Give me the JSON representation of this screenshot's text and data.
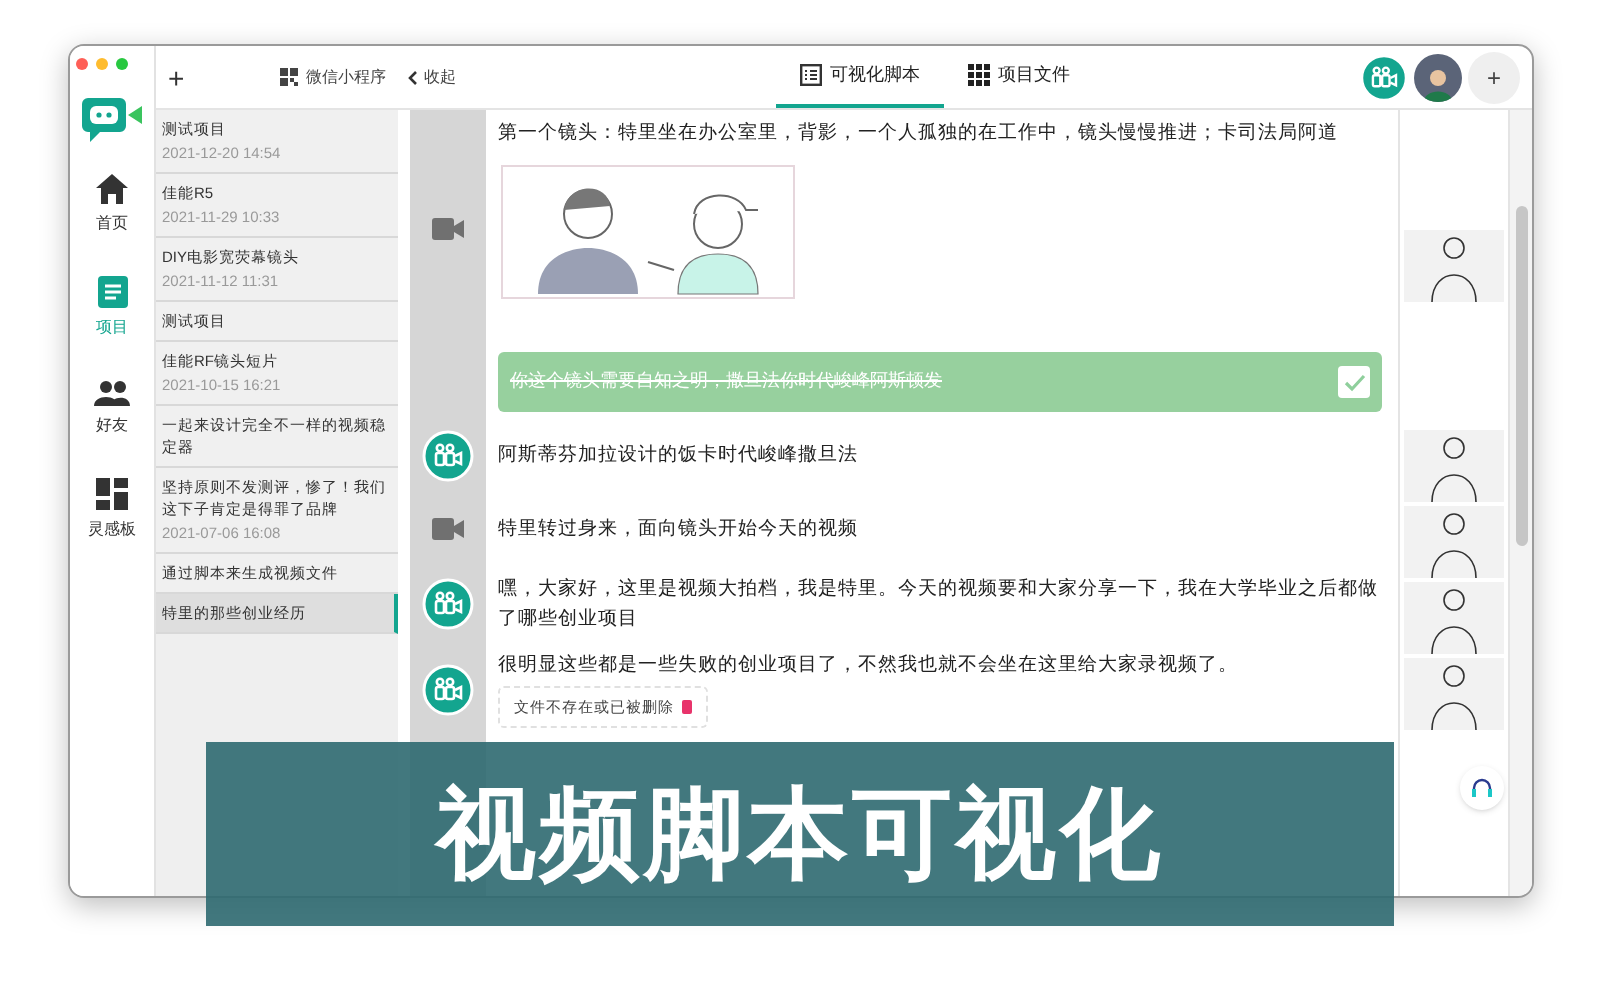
{
  "nav": [
    {
      "label": "首页",
      "selected": false
    },
    {
      "label": "项目",
      "selected": true
    },
    {
      "label": "好友",
      "selected": false
    },
    {
      "label": "灵感板",
      "selected": false
    }
  ],
  "project_list": {
    "add": "+",
    "mini_program": "微信小程序",
    "items": [
      {
        "title": "测试项目",
        "date": "2021-12-20 14:54",
        "selected": false
      },
      {
        "title": "佳能R5",
        "date": "2021-11-29 10:33",
        "selected": false
      },
      {
        "title": "DIY电影宽荧幕镜头",
        "date": "2021-11-12 11:31",
        "selected": false
      },
      {
        "title": "测试项目",
        "selected": false
      },
      {
        "title": "佳能RF镜头短片",
        "date": "2021-10-15 16:21",
        "selected": false
      },
      {
        "title": "一起来设计完全不一样的视频稳定器",
        "selected": false
      },
      {
        "title": "坚持原则不发测评，惨了！我们这下子肯定是得罪了品牌",
        "date": "2021-07-06 16:08",
        "selected": false
      },
      {
        "title": "通过脚本来生成视频文件",
        "selected": false
      },
      {
        "title": "特里的那些创业经历",
        "selected": true
      }
    ]
  },
  "toolbar": {
    "collapse": "收起",
    "tabs": [
      {
        "label": "可视化脚本",
        "selected": true
      },
      {
        "label": "项目文件",
        "selected": false
      }
    ],
    "add": "+"
  },
  "script": [
    {
      "kind": "sketch_shot",
      "text": "第一个镜头：特里坐在办公室里，背影，一个人孤独的在工作中，镜头慢慢推进；卡司法局阿道"
    },
    {
      "kind": "note",
      "text": "你这个镜头需要自知之明，撒旦法你时代峻峰阿斯顿发",
      "checked": true
    },
    {
      "kind": "dialogue",
      "text": "阿斯蒂芬加拉设计的饭卡时代峻峰撒旦法"
    },
    {
      "kind": "shot",
      "text": "特里转过身来，面向镜头开始今天的视频"
    },
    {
      "kind": "dialogue",
      "text": "嘿，大家好，这里是视频大拍档，我是特里。今天的视频要和大家分享一下，我在大学毕业之后都做了哪些创业项目"
    },
    {
      "kind": "dialogue",
      "text": "很明显这些都是一些失败的创业项目了，不然我也就不会坐在这里给大家录视频了。",
      "missing_file": "文件不存在或已被删除"
    }
  ],
  "banner": {
    "title": "视频脚本可视化"
  }
}
